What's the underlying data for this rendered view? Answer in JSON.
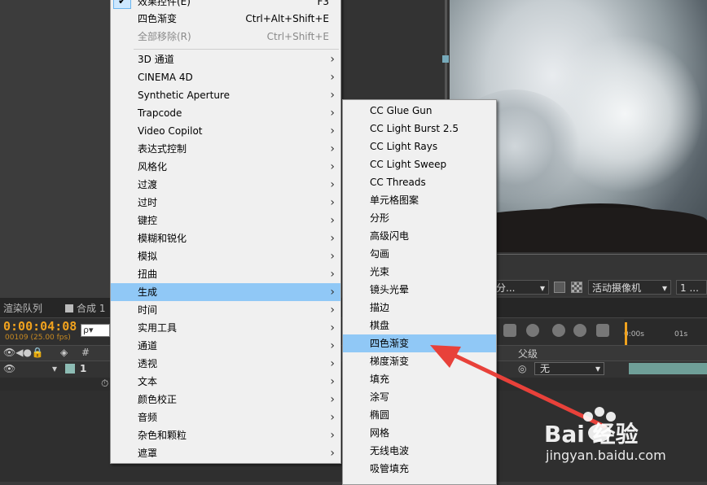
{
  "app": {
    "timeline": {
      "tabs": [
        {
          "label": "渲染队列"
        },
        {
          "label": "合成 1"
        }
      ],
      "timecode": "0:00:04:08",
      "frame_info": "00109 (25.00 fps)",
      "search_placeholder": "ρ▾",
      "parent_header": "父级",
      "layer_number": "1",
      "parent_value": "无",
      "ruler_ticks": [
        "0:00s",
        "01s"
      ]
    },
    "viewer_bar": {
      "resolution": "分...",
      "camera": "活动摄像机",
      "views": "1 ..."
    }
  },
  "context_menu": {
    "items": [
      {
        "label": "效果控件(E)",
        "shortcut": "F3",
        "checked": true
      },
      {
        "label": "四色渐变",
        "shortcut": "Ctrl+Alt+Shift+E"
      },
      {
        "label": "全部移除(R)",
        "shortcut": "Ctrl+Shift+E",
        "disabled": true
      },
      {
        "label": "3D 通道",
        "submenu": true
      },
      {
        "label": "CINEMA 4D",
        "submenu": true
      },
      {
        "label": "Synthetic Aperture",
        "submenu": true
      },
      {
        "label": "Trapcode",
        "submenu": true
      },
      {
        "label": "Video Copilot",
        "submenu": true
      },
      {
        "label": "表达式控制",
        "submenu": true
      },
      {
        "label": "风格化",
        "submenu": true
      },
      {
        "label": "过渡",
        "submenu": true
      },
      {
        "label": "过时",
        "submenu": true
      },
      {
        "label": "键控",
        "submenu": true
      },
      {
        "label": "模糊和锐化",
        "submenu": true
      },
      {
        "label": "模拟",
        "submenu": true
      },
      {
        "label": "扭曲",
        "submenu": true
      },
      {
        "label": "生成",
        "submenu": true,
        "highlighted": true
      },
      {
        "label": "时间",
        "submenu": true
      },
      {
        "label": "实用工具",
        "submenu": true
      },
      {
        "label": "通道",
        "submenu": true
      },
      {
        "label": "透视",
        "submenu": true
      },
      {
        "label": "文本",
        "submenu": true
      },
      {
        "label": "颜色校正",
        "submenu": true
      },
      {
        "label": "音频",
        "submenu": true
      },
      {
        "label": "杂色和颗粒",
        "submenu": true
      },
      {
        "label": "遮罩",
        "submenu": true
      }
    ]
  },
  "submenu_generate": {
    "items": [
      {
        "label": "CC Glue Gun"
      },
      {
        "label": "CC Light Burst 2.5"
      },
      {
        "label": "CC Light Rays"
      },
      {
        "label": "CC Light Sweep"
      },
      {
        "label": "CC Threads"
      },
      {
        "label": "单元格图案"
      },
      {
        "label": "分形"
      },
      {
        "label": "高级闪电"
      },
      {
        "label": "勾画"
      },
      {
        "label": "光束"
      },
      {
        "label": "镜头光晕"
      },
      {
        "label": "描边"
      },
      {
        "label": "棋盘"
      },
      {
        "label": "四色渐变",
        "highlighted": true
      },
      {
        "label": "梯度渐变"
      },
      {
        "label": "填充"
      },
      {
        "label": "涂写"
      },
      {
        "label": "椭圆"
      },
      {
        "label": "网格"
      },
      {
        "label": "无线电波"
      },
      {
        "label": "吸管填充"
      }
    ]
  },
  "watermark": {
    "brand": "Bai 经验",
    "url": "jingyan.baidu.com"
  },
  "colors": {
    "menu_highlight": "#90c8f6",
    "timecode": "#f0a21e",
    "arrow": "#e8413a"
  }
}
